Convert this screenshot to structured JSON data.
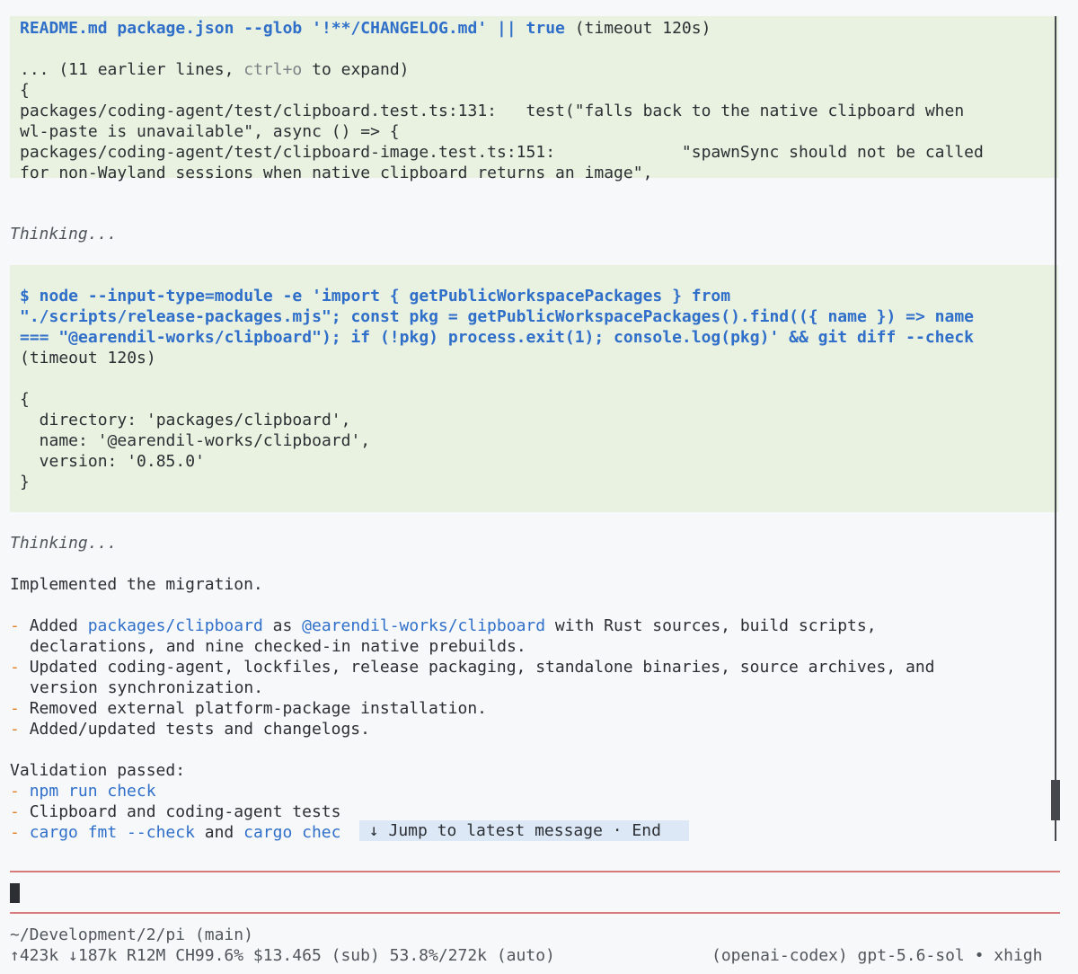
{
  "tool_block_1": {
    "cmd_text": "README.md package.json --glob '!**/CHANGELOG.md' || true",
    "timeout_text": " (timeout 120s)",
    "expand_prefix": "... (11 earlier lines, ",
    "expand_key": "ctrl+o",
    "expand_suffix": " to expand)",
    "output_lines": [
      "{",
      "packages/coding-agent/test/clipboard.test.ts:131:   test(\"falls back to the native clipboard when",
      "wl-paste is unavailable\", async () => {",
      "packages/coding-agent/test/clipboard-image.test.ts:151:             \"spawnSync should not be called",
      "for non-Wayland sessions when native clipboard returns an image\","
    ]
  },
  "thinking_label": "Thinking...",
  "tool_block_2": {
    "cmd_lines": [
      "$ node --input-type=module -e 'import { getPublicWorkspacePackages } from",
      "\"./scripts/release-packages.mjs\"; const pkg = getPublicWorkspacePackages().find(({ name }) => name",
      "=== \"@earendil-works/clipboard\"); if (!pkg) process.exit(1); console.log(pkg)' && git diff --check"
    ],
    "timeout_text": "(timeout 120s)",
    "output_lines": [
      "{",
      "  directory: 'packages/clipboard',",
      "  name: '@earendil-works/clipboard',",
      "  version: '0.85.0'",
      "}"
    ]
  },
  "assistant": {
    "intro": "Implemented the migration.",
    "bullet_marker": "-",
    "bullet1_a": "Added ",
    "bullet1_path": "packages/clipboard",
    "bullet1_b": " as ",
    "bullet1_pkg": "@earendil-works/clipboard",
    "bullet1_c": " with Rust sources, build scripts,",
    "bullet1_d": "declarations, and nine checked-in native prebuilds.",
    "bullet2_a": "Updated coding-agent, lockfiles, release packaging, standalone binaries, source archives, and",
    "bullet2_b": "version synchronization.",
    "bullet3": "Removed external platform-package installation.",
    "bullet4": "Added/updated tests and changelogs.",
    "validation_heading": "Validation passed:",
    "v1": "npm run check",
    "v2": "Clipboard and coding-agent tests",
    "v3_a": "cargo fmt --check",
    "v3_b": " and ",
    "v3_c": "cargo chec"
  },
  "jump_banner": " ↓ Jump to latest message · End",
  "footer": {
    "cwd": "~/Development/2/pi (main)",
    "stats": "↑423k ↓187k R12M CH99.6% $13.465 (sub) 53.8%/272k (auto)",
    "model": "(openai-codex) gpt-5.6-sol • xhigh"
  },
  "colors": {
    "tool_block_bg": "#e9f1e0",
    "accent_blue": "#2f6fc9",
    "bullet_orange": "#e0832a",
    "separator_red": "#d77a7a"
  }
}
